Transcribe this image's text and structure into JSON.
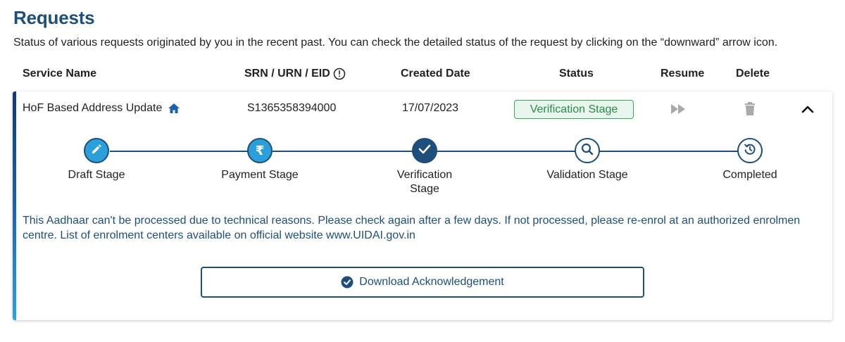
{
  "page": {
    "title": "Requests",
    "description": "Status of various requests originated by you in the recent past. You can check the detailed status of the request by clicking on the “downward” arrow icon."
  },
  "table": {
    "headers": {
      "service_name": "Service Name",
      "srn": "SRN / URN / EID",
      "created_date": "Created Date",
      "status": "Status",
      "resume": "Resume",
      "delete": "Delete"
    },
    "rows": [
      {
        "service_name": "HoF Based Address Update",
        "srn": "S1365358394000",
        "created_date": "17/07/2023",
        "status": "Verification Stage",
        "stages": [
          {
            "label": "Draft Stage",
            "state": "done",
            "icon": "pencil-icon"
          },
          {
            "label": "Payment Stage",
            "state": "done",
            "icon": "rupee-icon"
          },
          {
            "label": "Verification Stage",
            "state": "current",
            "icon": "check-icon"
          },
          {
            "label": "Validation Stage",
            "state": "pending",
            "icon": "magnifier-icon"
          },
          {
            "label": "Completed",
            "state": "pending",
            "icon": "refresh-icon"
          }
        ],
        "message": "This Aadhaar can't be processed due to technical reasons. Please check again after a few days. If not processed, please re-enrol at an authorized enrolment centre. List of enrolment centers available on official website www.UIDAI.gov.in",
        "message_line1": "This Aadhaar can't be processed due to technical reasons. Please check again after a few days. If not processed, please re-enrol at an authorized enrolmen",
        "message_line2": "centre. List of enrolment centers available on official website www.UIDAI.gov.in",
        "download_label": "Download Acknowledgement"
      }
    ]
  },
  "colors": {
    "primary": "#1d4f7a",
    "stage_done": "#2a9fd9",
    "status_green": "#2b8a4d",
    "status_bg": "#e7f5ec"
  },
  "icons": {
    "srn_info": "info-circle-icon",
    "service": "home-icon",
    "resume": "fast-forward-icon",
    "delete": "trash-icon",
    "collapse": "chevron-up-icon",
    "download": "check-circle-icon"
  }
}
